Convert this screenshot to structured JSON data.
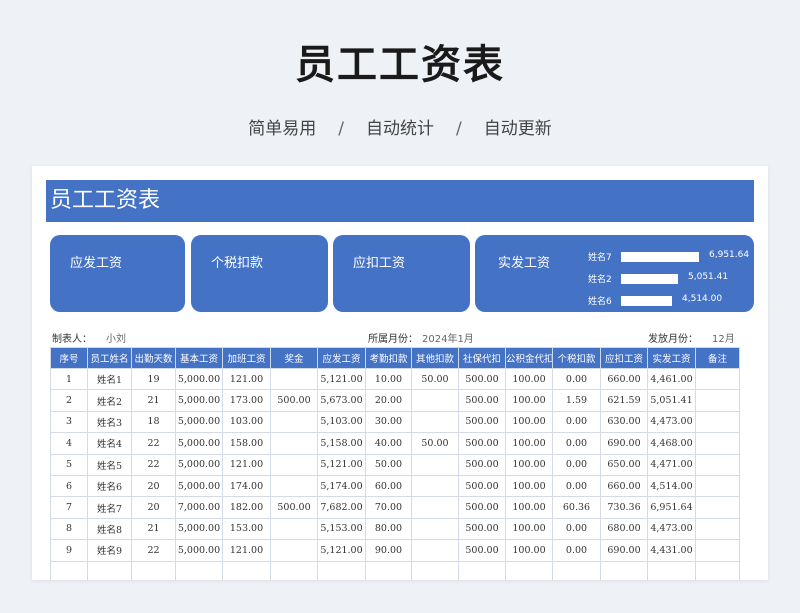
{
  "hero": {
    "title": "员工工资表",
    "tags": [
      "简单易用",
      "自动统计",
      "自动更新"
    ],
    "separator": "/"
  },
  "sheet": {
    "banner_title": "员工工资表",
    "cards": [
      {
        "label": "应发工资"
      },
      {
        "label": "个税扣款"
      },
      {
        "label": "应扣工资"
      },
      {
        "label": "实发工资"
      }
    ],
    "top_salaries": [
      {
        "name": "姓名7",
        "value": "6,951.64",
        "amount": 6951.64
      },
      {
        "name": "姓名2",
        "value": "5,051.41",
        "amount": 5051.41
      },
      {
        "name": "姓名6",
        "value": "4,514.00",
        "amount": 4514.0
      }
    ],
    "meta": {
      "maker_label": "制表人：",
      "maker_value": "小刘",
      "month_label": "所属月份：",
      "month_value": "2024年1月",
      "payday_label": "发放月份：",
      "payday_value": "12月"
    },
    "columns": [
      "序号",
      "员工姓名",
      "出勤天数",
      "基本工资",
      "加班工资",
      "奖金",
      "应发工资",
      "考勤扣款",
      "其他扣款",
      "社保代扣",
      "公积金代扣",
      "个税扣款",
      "应扣工资",
      "实发工资",
      "备注"
    ],
    "rows": [
      [
        "1",
        "姓名1",
        "19",
        "5,000.00",
        "121.00",
        "",
        "5,121.00",
        "10.00",
        "50.00",
        "500.00",
        "100.00",
        "0.00",
        "660.00",
        "4,461.00",
        ""
      ],
      [
        "2",
        "姓名2",
        "21",
        "5,000.00",
        "173.00",
        "500.00",
        "5,673.00",
        "20.00",
        "",
        "500.00",
        "100.00",
        "1.59",
        "621.59",
        "5,051.41",
        ""
      ],
      [
        "3",
        "姓名3",
        "18",
        "5,000.00",
        "103.00",
        "",
        "5,103.00",
        "30.00",
        "",
        "500.00",
        "100.00",
        "0.00",
        "630.00",
        "4,473.00",
        ""
      ],
      [
        "4",
        "姓名4",
        "22",
        "5,000.00",
        "158.00",
        "",
        "5,158.00",
        "40.00",
        "50.00",
        "500.00",
        "100.00",
        "0.00",
        "690.00",
        "4,468.00",
        ""
      ],
      [
        "5",
        "姓名5",
        "22",
        "5,000.00",
        "121.00",
        "",
        "5,121.00",
        "50.00",
        "",
        "500.00",
        "100.00",
        "0.00",
        "650.00",
        "4,471.00",
        ""
      ],
      [
        "6",
        "姓名6",
        "20",
        "5,000.00",
        "174.00",
        "",
        "5,174.00",
        "60.00",
        "",
        "500.00",
        "100.00",
        "0.00",
        "660.00",
        "4,514.00",
        ""
      ],
      [
        "7",
        "姓名7",
        "20",
        "7,000.00",
        "182.00",
        "500.00",
        "7,682.00",
        "70.00",
        "",
        "500.00",
        "100.00",
        "60.36",
        "730.36",
        "6,951.64",
        ""
      ],
      [
        "8",
        "姓名8",
        "21",
        "5,000.00",
        "153.00",
        "",
        "5,153.00",
        "80.00",
        "",
        "500.00",
        "100.00",
        "0.00",
        "680.00",
        "4,473.00",
        ""
      ],
      [
        "9",
        "姓名9",
        "22",
        "5,000.00",
        "121.00",
        "",
        "5,121.00",
        "90.00",
        "",
        "500.00",
        "100.00",
        "0.00",
        "690.00",
        "4,431.00",
        ""
      ]
    ]
  }
}
